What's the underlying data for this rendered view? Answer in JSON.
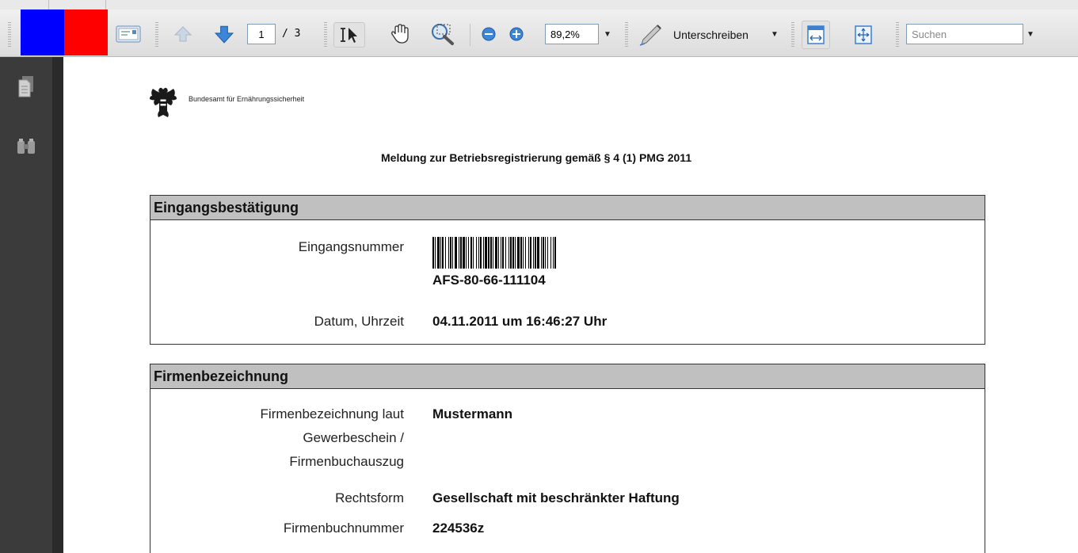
{
  "toolbar": {
    "page_current": "1",
    "page_total": "/ 3",
    "zoom": "89,2%",
    "sign_label": "Unterschreiben",
    "search_placeholder": "Suchen",
    "swatch_colors": [
      "#0000ff",
      "#ff0000"
    ]
  },
  "document": {
    "agency": "Bundesamt für Ernährungssicherheit",
    "title": "Meldung zur Betriebsregistrierung gemäß § 4 (1) PMG 2011",
    "sections": [
      {
        "heading": "Eingangsbestätigung",
        "eingangsnummer_label": "Eingangsnummer",
        "eingangsnummer_value": "AFS-80-66-111104",
        "datum_label": "Datum, Uhrzeit",
        "datum_value": "04.11.2011 um 16:46:27 Uhr"
      },
      {
        "heading": "Firmenbezeichnung",
        "firma_label_1": "Firmenbezeichnung laut",
        "firma_label_2": "Gewerbeschein /",
        "firma_label_3": "Firmenbuchauszug",
        "firma_value": "Mustermann",
        "rechtsform_label": "Rechtsform",
        "rechtsform_value": "Gesellschaft mit beschränkter Haftung",
        "fbnr_label": "Firmenbuchnummer",
        "fbnr_value": "224536z"
      }
    ]
  }
}
